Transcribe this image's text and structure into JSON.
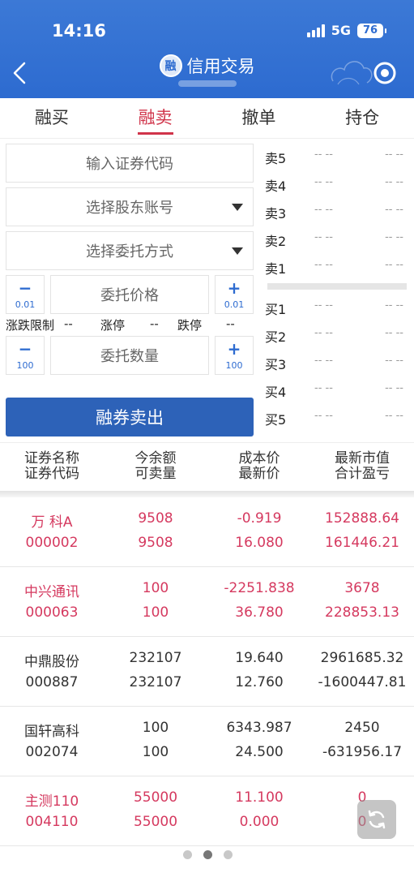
{
  "status": {
    "time": "14:16",
    "network": "5G",
    "battery": "76"
  },
  "header": {
    "badge": "融",
    "title": "信用交易"
  },
  "tabs": [
    {
      "label": "融买"
    },
    {
      "label": "融卖"
    },
    {
      "label": "撤单"
    },
    {
      "label": "持仓"
    }
  ],
  "form": {
    "code_placeholder": "输入证券代码",
    "account_placeholder": "选择股东账号",
    "method_placeholder": "选择委托方式",
    "price_placeholder": "委托价格",
    "price_step": "0.01",
    "qty_placeholder": "委托数量",
    "qty_step": "100",
    "minus": "−",
    "plus": "+",
    "limit_label": "涨跌限制",
    "limit_value": "--",
    "up_label": "涨停",
    "up_value": "--",
    "down_label": "跌停",
    "down_value": "--",
    "submit_label": "融券卖出"
  },
  "orderbook": {
    "sell": [
      {
        "label": "卖5",
        "price": "-- --",
        "vol": "-- --"
      },
      {
        "label": "卖4",
        "price": "-- --",
        "vol": "-- --"
      },
      {
        "label": "卖3",
        "price": "-- --",
        "vol": "-- --"
      },
      {
        "label": "卖2",
        "price": "-- --",
        "vol": "-- --"
      },
      {
        "label": "卖1",
        "price": "-- --",
        "vol": "-- --"
      }
    ],
    "buy": [
      {
        "label": "买1",
        "price": "-- --",
        "vol": "-- --"
      },
      {
        "label": "买2",
        "price": "-- --",
        "vol": "-- --"
      },
      {
        "label": "买3",
        "price": "-- --",
        "vol": "-- --"
      },
      {
        "label": "买4",
        "price": "-- --",
        "vol": "-- --"
      },
      {
        "label": "买5",
        "price": "-- --",
        "vol": "-- --"
      }
    ]
  },
  "table": {
    "headers": [
      {
        "l1": "证券名称",
        "l2": "证券代码"
      },
      {
        "l1": "今余额",
        "l2": "可卖量"
      },
      {
        "l1": "成本价",
        "l2": "最新价"
      },
      {
        "l1": "最新市值",
        "l2": "合计盈亏"
      }
    ],
    "rows": [
      {
        "name": "万 科A",
        "code": "000002",
        "balance": "9508",
        "sellable": "9508",
        "cost": "-0.919",
        "last": "16.080",
        "value": "152888.64",
        "pnl": "161446.21",
        "color": "red"
      },
      {
        "name": "中兴通讯",
        "code": "000063",
        "balance": "100",
        "sellable": "100",
        "cost": "-2251.838",
        "last": "36.780",
        "value": "3678",
        "pnl": "228853.13",
        "color": "red"
      },
      {
        "name": "中鼎股份",
        "code": "000887",
        "balance": "232107",
        "sellable": "232107",
        "cost": "19.640",
        "last": "12.760",
        "value": "2961685.32",
        "pnl": "-1600447.81",
        "color": "dark"
      },
      {
        "name": "国轩高科",
        "code": "002074",
        "balance": "100",
        "sellable": "100",
        "cost": "6343.987",
        "last": "24.500",
        "value": "2450",
        "pnl": "-631956.17",
        "color": "dark"
      },
      {
        "name": "主测110",
        "code": "004110",
        "balance": "55000",
        "sellable": "55000",
        "cost": "11.100",
        "last": "0.000",
        "value": "0",
        "pnl": "0",
        "color": "red"
      }
    ]
  }
}
